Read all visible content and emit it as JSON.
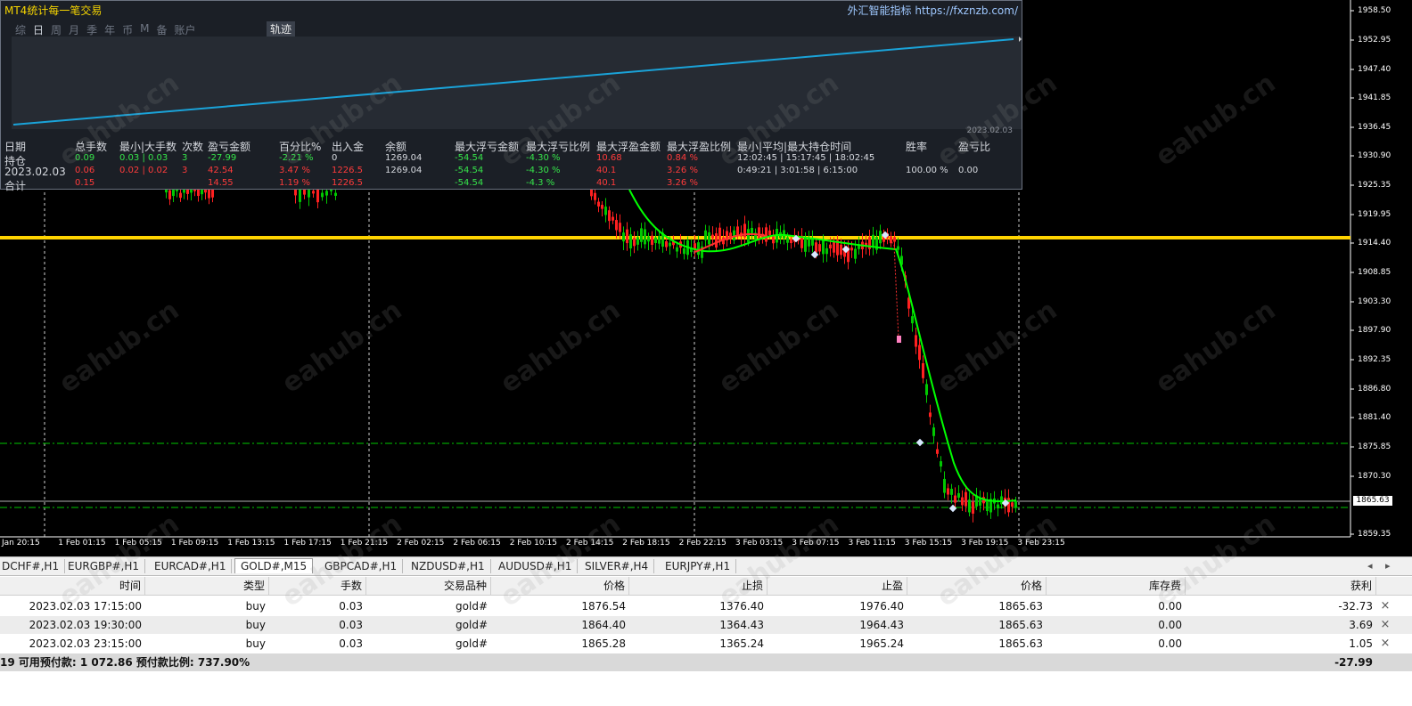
{
  "chart": {
    "symbol_tab_active": "GOLD#,M15",
    "current_price": "1865.63",
    "price_axis": [
      "1958.50",
      "1952.95",
      "1947.40",
      "1941.85",
      "1936.45",
      "1930.90",
      "1925.35",
      "1919.95",
      "1914.40",
      "1908.85",
      "1903.30",
      "1897.90",
      "1892.35",
      "1886.80",
      "1881.40",
      "1875.85",
      "1870.30",
      "1859.35"
    ],
    "time_axis": [
      "Jan 20:15",
      "1 Feb 01:15",
      "1 Feb 05:15",
      "1 Feb 09:15",
      "1 Feb 13:15",
      "1 Feb 17:15",
      "1 Feb 21:15",
      "2 Feb 02:15",
      "2 Feb 06:15",
      "2 Feb 10:15",
      "2 Feb 14:15",
      "2 Feb 18:15",
      "2 Feb 22:15",
      "3 Feb 03:15",
      "3 Feb 07:15",
      "3 Feb 11:15",
      "3 Feb 15:15",
      "3 Feb 19:15",
      "3 Feb 23:15"
    ],
    "watermark": "eahub.cn",
    "colors": {
      "background": "#000000",
      "bull": "#00c800",
      "bear": "#ff2020",
      "ma": "#00ff00",
      "level_line": "#ffd400",
      "stop_line": "#00c800"
    }
  },
  "panel": {
    "title": "MT4统计每一笔交易",
    "brand": "外汇智能指标",
    "brand_url": "https://fxznzb.com/",
    "tabs": [
      "综",
      "日",
      "周",
      "月",
      "季",
      "年",
      "币",
      "M",
      "备",
      "账户"
    ],
    "active_tab": "日",
    "track_button": "轨迹",
    "equity_date": "2023.02.03",
    "headers": [
      "日期",
      "总手数",
      "最小|大手数",
      "次数",
      "盈亏金额",
      "百分比%",
      "出入金",
      "余额",
      "最大浮亏金额",
      "最大浮亏比例",
      "最大浮盈金额",
      "最大浮盈比例",
      "最小|平均|最大持仓时间",
      "胜率",
      "盈亏比"
    ],
    "rows": [
      {
        "date": "持仓",
        "lots": "0.09",
        "minmax": "0.03 | 0.03",
        "count": "3",
        "pl": "-27.99",
        "pct": "-2.21 %",
        "deposit": "0",
        "balance": "1269.04",
        "max_float_loss": "-54.54",
        "max_float_loss_pct": "-4.30 %",
        "max_float_profit": "10.68",
        "max_float_profit_pct": "0.84 %",
        "hold": "12:02:45 | 15:17:45 | 18:02:45",
        "win": "",
        "ratio": ""
      },
      {
        "date": "2023.02.03",
        "lots": "0.06",
        "minmax": "0.02 | 0.02",
        "count": "3",
        "pl": "42.54",
        "pct": "3.47 %",
        "deposit": "1226.5",
        "balance": "1269.04",
        "max_float_loss": "-54.54",
        "max_float_loss_pct": "-4.30 %",
        "max_float_profit": "40.1",
        "max_float_profit_pct": "3.26 %",
        "hold": "0:49:21 | 3:01:58 | 6:15:00",
        "win": "100.00 %",
        "ratio": "0.00"
      },
      {
        "date": "合计",
        "lots": "0.15",
        "minmax": "",
        "count": "",
        "pl": "14.55",
        "pct": "1.19 %",
        "deposit": "1226.5",
        "balance": "",
        "max_float_loss": "-54.54",
        "max_float_loss_pct": "-4.3 %",
        "max_float_profit": "40.1",
        "max_float_profit_pct": "3.26 %",
        "hold": "",
        "win": "",
        "ratio": ""
      }
    ]
  },
  "symbol_tabs": [
    "DCHF#,H1",
    "EURGBP#,H1",
    "EURCAD#,H1",
    "GOLD#,M15",
    "GBPCAD#,H1",
    "NZDUSD#,H1",
    "AUDUSD#,H1",
    "SILVER#,H4",
    "EURJPY#,H1"
  ],
  "orders": {
    "headers": [
      "时间",
      "类型",
      "手数",
      "交易品种",
      "价格",
      "止损",
      "止盈",
      "价格",
      "库存费",
      "获利"
    ],
    "rows": [
      [
        "2023.02.03 17:15:00",
        "buy",
        "0.03",
        "gold#",
        "1876.54",
        "1376.40",
        "1976.40",
        "1865.63",
        "0.00",
        "-32.73"
      ],
      [
        "2023.02.03 19:30:00",
        "buy",
        "0.03",
        "gold#",
        "1864.40",
        "1364.43",
        "1964.43",
        "1865.63",
        "0.00",
        "3.69"
      ],
      [
        "2023.02.03 23:15:00",
        "buy",
        "0.03",
        "gold#",
        "1865.28",
        "1365.24",
        "1965.24",
        "1865.63",
        "0.00",
        "1.05"
      ]
    ],
    "summary_left": "19  可用预付款: 1 072.86  预付款比例: 737.90%",
    "summary_total": "-27.99"
  }
}
